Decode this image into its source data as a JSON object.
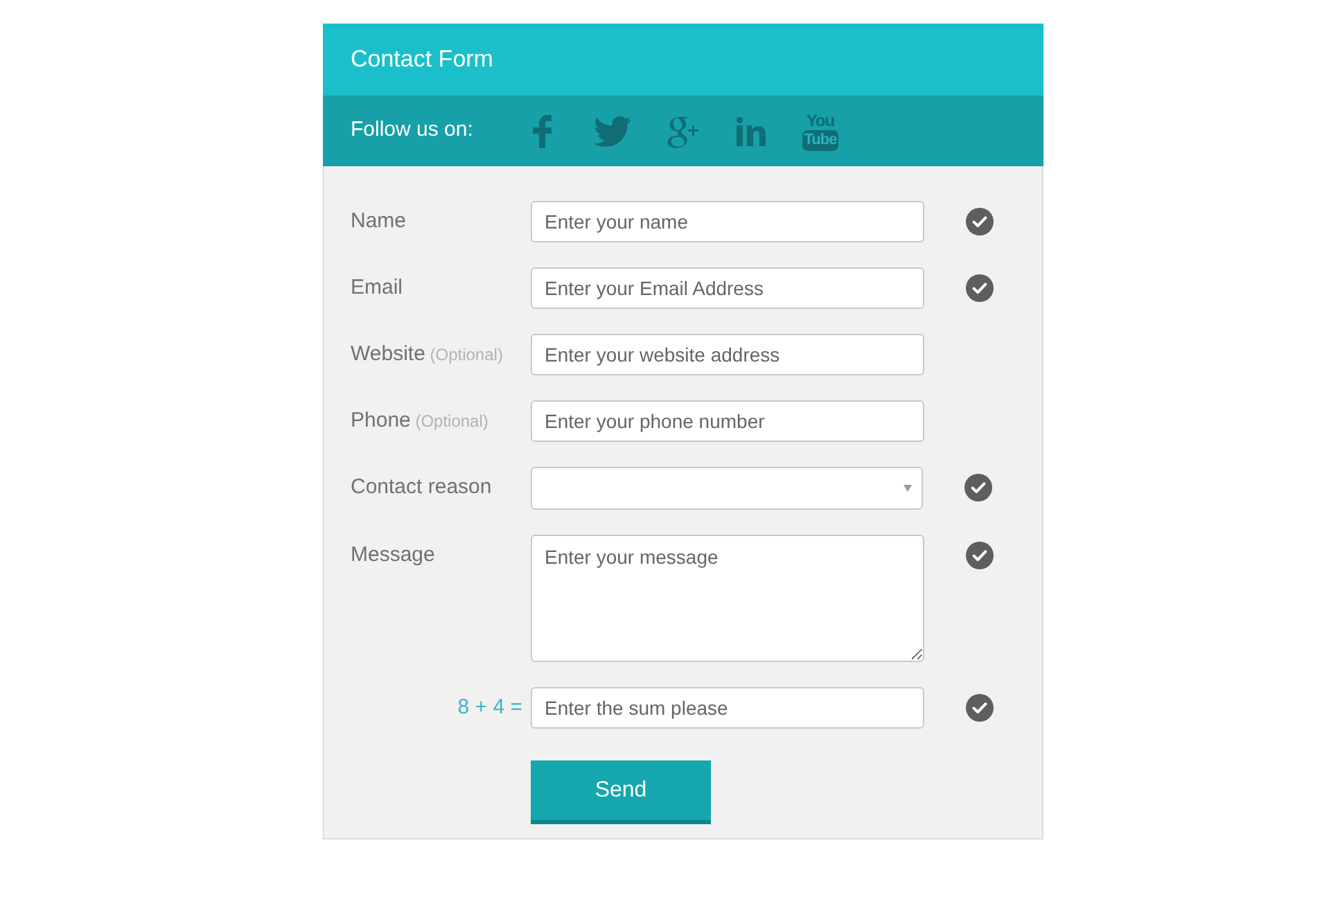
{
  "header": {
    "title": "Contact Form"
  },
  "social_bar": {
    "label": "Follow us on:",
    "youtube_logo": {
      "top": "You",
      "bottom": "Tube"
    }
  },
  "fields": [
    {
      "kind": "input",
      "label": "Name",
      "placeholder": "Enter your name",
      "valid": true
    },
    {
      "kind": "input",
      "label": "Email",
      "placeholder": "Enter your Email Address",
      "valid": true
    },
    {
      "kind": "input",
      "label": "Website",
      "note": "(Optional)",
      "placeholder": "Enter your website address",
      "valid": false
    },
    {
      "kind": "input",
      "label": "Phone",
      "note": "(Optional)",
      "placeholder": "Enter your phone number",
      "valid": false
    },
    {
      "kind": "select",
      "label": "Contact reason",
      "valid": true
    },
    {
      "kind": "textarea",
      "label": "Message",
      "placeholder": "Enter your message",
      "valid": true
    },
    {
      "kind": "captcha",
      "label": "8 + 4 =",
      "placeholder": "Enter the sum please",
      "valid": true
    }
  ],
  "submit_button": {
    "label": "Send"
  }
}
